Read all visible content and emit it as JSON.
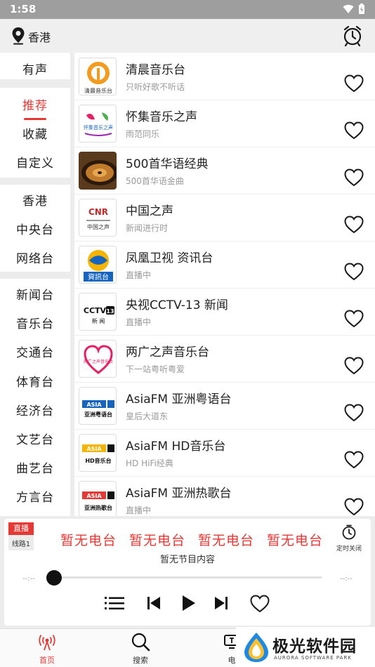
{
  "status_bar": {
    "time": "1:58"
  },
  "header": {
    "location": "香港"
  },
  "sidebar": {
    "group1": [
      "有声"
    ],
    "group2": [
      "推荐",
      "收藏",
      "自定义"
    ],
    "group3": [
      "香港",
      "中央台",
      "网络台"
    ],
    "group4": [
      "新闻台",
      "音乐台",
      "交通台",
      "体育台",
      "经济台",
      "文艺台",
      "曲艺台",
      "方言台"
    ]
  },
  "stations": [
    {
      "name": "清晨音乐台",
      "subtitle": "只听好歌不听话",
      "logo_text": "清晨音乐台"
    },
    {
      "name": "怀集音乐之声",
      "subtitle": "雨范同乐",
      "logo_text": "怀集音乐之声"
    },
    {
      "name": "500首华语经典",
      "subtitle": "500首华语金曲",
      "logo_text": ""
    },
    {
      "name": "中国之声",
      "subtitle": "新闻进行时",
      "logo_text": "CNR",
      "logo_text2": "中国之声"
    },
    {
      "name": "凤凰卫视 资讯台",
      "subtitle": "直播中",
      "logo_text": "資訊台"
    },
    {
      "name": "央视CCTV-13 新闻",
      "subtitle": "直播中",
      "logo_text": "CCTV",
      "logo_text2": "新 闻",
      "logo_num": "13"
    },
    {
      "name": "两广之声音乐台",
      "subtitle": "下一站粤听粤爱",
      "logo_text": "两广之声音乐台"
    },
    {
      "name": "AsiaFM 亚洲粤语台",
      "subtitle": "皇后大道东",
      "logo_text": "ASIA",
      "logo_text2": "亚洲粤语台"
    },
    {
      "name": "AsiaFM HD音乐台",
      "subtitle": "HD HiFi经典",
      "logo_text": "ASIA",
      "logo_text2": "HD音乐台"
    },
    {
      "name": "AsiaFM 亚洲热歌台",
      "subtitle": "直播中",
      "logo_text": "ASIA",
      "logo_text2": "亚洲热歌台"
    }
  ],
  "player": {
    "live_label": "直播",
    "line_label": "线路1",
    "marquee": [
      "暂无电台",
      "暂无电台",
      "暂无电台",
      "暂无电台"
    ],
    "program": "暂无节目内容",
    "timer_label": "定时关闭",
    "time_current": "--:--",
    "time_total": "--:--",
    "progress": 0
  },
  "tabs": [
    {
      "label": "首页",
      "icon": "radio-icon",
      "active": true
    },
    {
      "label": "搜索",
      "icon": "search-icon",
      "active": false
    },
    {
      "label": "电",
      "icon": "tv-icon",
      "active": false
    }
  ],
  "watermark": {
    "title": "极光软件园",
    "subtitle": "AURORA SOFTWARE PARK"
  },
  "colors": {
    "accent": "#e53935",
    "status_bar": "#9e9e9e",
    "sidebar_bg": "#ececec"
  }
}
